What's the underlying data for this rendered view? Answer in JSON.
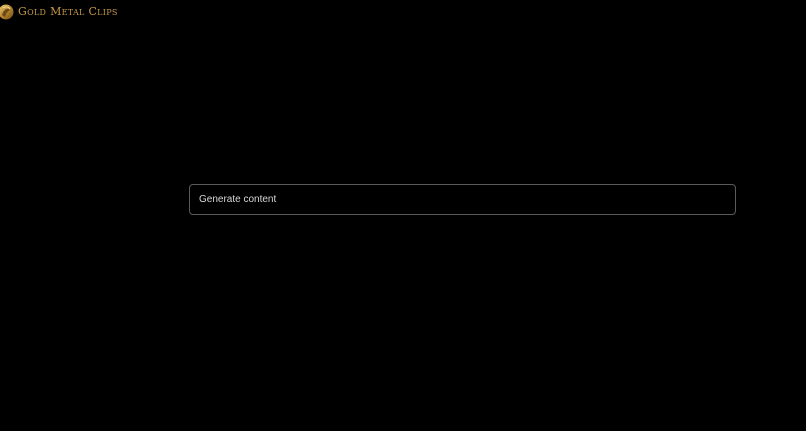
{
  "brand": {
    "name": "Gold Metal Clips",
    "logo_icon": "gold-clip-logo-icon"
  },
  "prompt": {
    "label": "Generate content"
  },
  "colors": {
    "background": "#000000",
    "brand_gold": "#c79a4a",
    "box_border": "#5a5a5a",
    "text": "#d9d9d9"
  }
}
